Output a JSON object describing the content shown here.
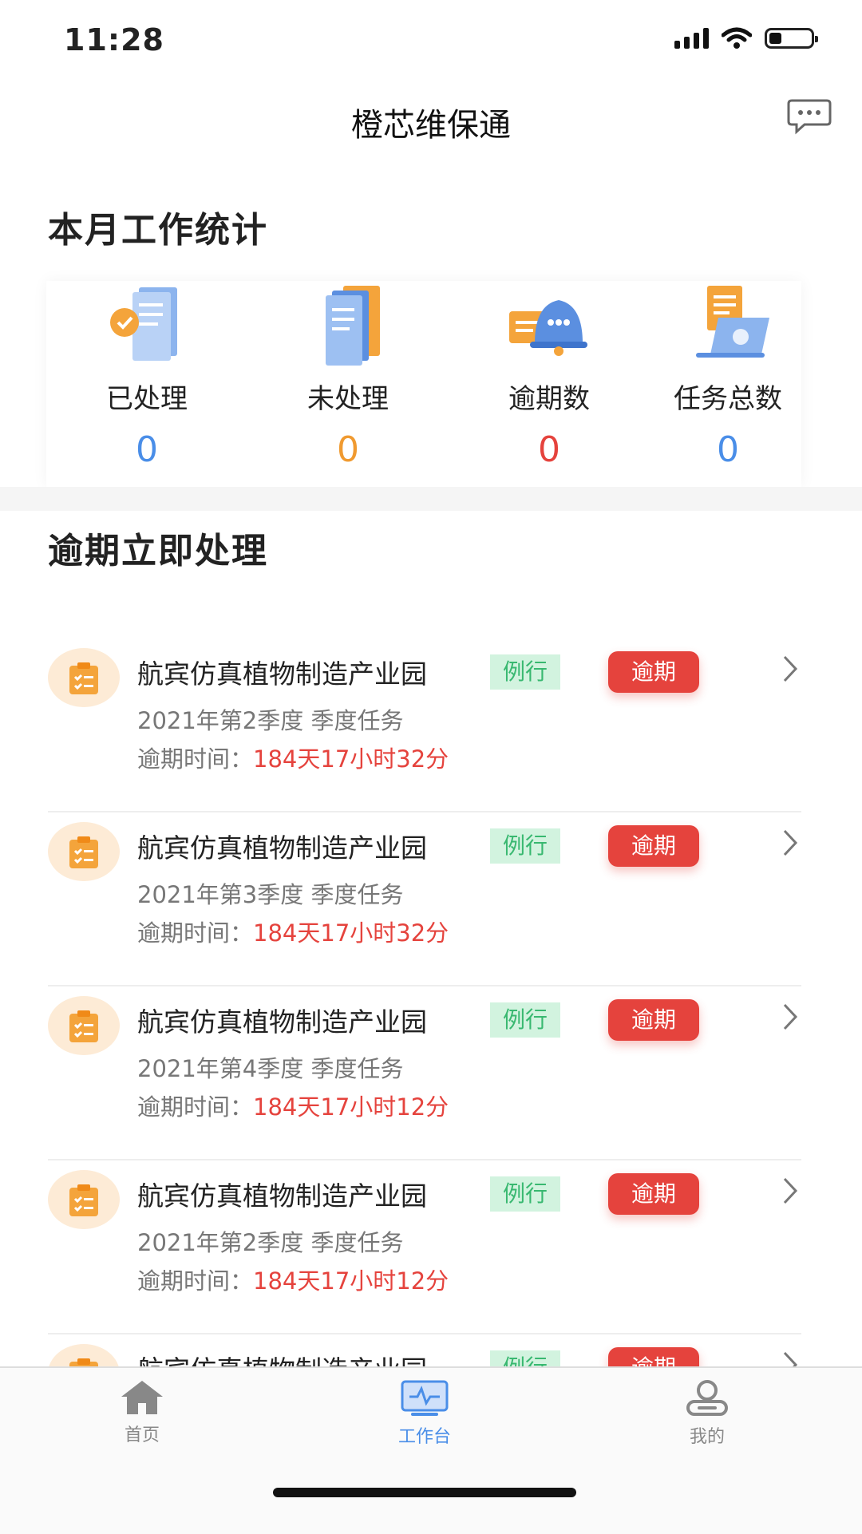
{
  "status_bar": {
    "time": "11:28",
    "battery_level": 0.3
  },
  "header": {
    "title": "橙芯维保通"
  },
  "stats_section": {
    "title": "本月工作统计",
    "items": [
      {
        "label": "已处理",
        "value": "0",
        "color": "#4a8ee8",
        "icon": "processed-documents-icon"
      },
      {
        "label": "未处理",
        "value": "0",
        "color": "#f09a30",
        "icon": "unprocessed-documents-icon"
      },
      {
        "label": "逾期数",
        "value": "0",
        "color": "#e5433d",
        "icon": "overdue-bell-icon"
      },
      {
        "label": "任务总数",
        "value": "0",
        "color": "#4a8ee8",
        "icon": "task-laptop-icon"
      }
    ]
  },
  "overdue_section": {
    "title": "逾期立即处理",
    "due_prefix": "逾期时间：",
    "items": [
      {
        "name": "航宾仿真植物制造产业园",
        "tag": "例行",
        "badge": "逾期",
        "subtitle": "2021年第2季度 季度任务",
        "due": "184天17小时32分"
      },
      {
        "name": "航宾仿真植物制造产业园",
        "tag": "例行",
        "badge": "逾期",
        "subtitle": "2021年第3季度 季度任务",
        "due": "184天17小时32分"
      },
      {
        "name": "航宾仿真植物制造产业园",
        "tag": "例行",
        "badge": "逾期",
        "subtitle": "2021年第4季度 季度任务",
        "due": "184天17小时12分"
      },
      {
        "name": "航宾仿真植物制造产业园",
        "tag": "例行",
        "badge": "逾期",
        "subtitle": "2021年第2季度 季度任务",
        "due": "184天17小时12分"
      },
      {
        "name": "航宾仿真植物制造产业园",
        "tag": "例行",
        "badge": "逾期",
        "subtitle": "",
        "due": ""
      }
    ]
  },
  "tabbar": {
    "items": [
      {
        "label": "首页",
        "icon": "home-icon",
        "active": false
      },
      {
        "label": "工作台",
        "icon": "workbench-icon",
        "active": true
      },
      {
        "label": "我的",
        "icon": "profile-icon",
        "active": false
      }
    ],
    "active_color": "#4a8ee8",
    "inactive_color": "#888888"
  }
}
